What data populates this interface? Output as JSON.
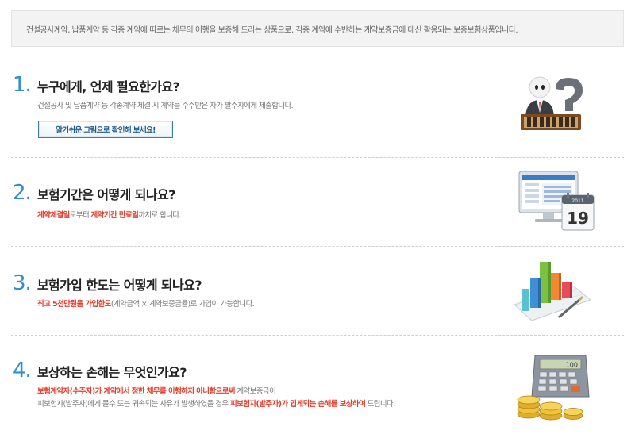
{
  "intro": {
    "text": "건설공사계약, 납품계약 등 각종 계약에 따르는 채무의 이행을 보증해 드리는 상품으로, 각종 계약에 수반하는 계약보증금에 대신 활용되는 보증보험상품입니다."
  },
  "sections": [
    {
      "number": "1.",
      "title": "누구에게, 언제 필요한가요?",
      "desc_plain": "건설공사 및 납품계약 등 각종계약 체결 시 계약을 수주받은 자가 발주자에게 제출합니다.",
      "button_label": "알기쉬운 그림으로  확인해 보세요!",
      "illustration": "person-question-icon"
    },
    {
      "number": "2.",
      "title": "보험기간은 어떻게 되나요?",
      "desc_red1": "계약체결일",
      "desc_mid": "로부터 ",
      "desc_red2": "계약기간 만료일",
      "desc_end": "까지로 합니다.",
      "calendar_year": "2011",
      "calendar_day": "19",
      "illustration": "monitor-calendar-icon"
    },
    {
      "number": "3.",
      "title": "보험가입 한도는 어떻게 되나요?",
      "desc_red": "최고 5천만원을 가입한도",
      "desc_end": "(계약금액 × 계약보증금율)로 가입이 가능합니다.",
      "illustration": "bar-chart-icon"
    },
    {
      "number": "4.",
      "title": "보상하는 손해는 무엇인가요?",
      "line1_red": "보험계약자(수주자)가 계약에서 정한 채무를 이행하지 아니함으로써",
      "line1_end": " 계약보증금이",
      "line2_start": "피보험자(발주자)에게 몰수 또는 귀속되는 사유가 발생하였을 경우 ",
      "line2_red": "피보험자(발주자)가 입게되는 손해를 보상하여",
      "line2_end": " 드립니다.",
      "calculator_display": "100",
      "illustration": "calculator-coins-icon"
    }
  ],
  "colors": {
    "accent_blue": "#2f8fc8",
    "highlight_red": "#e43b2a"
  }
}
